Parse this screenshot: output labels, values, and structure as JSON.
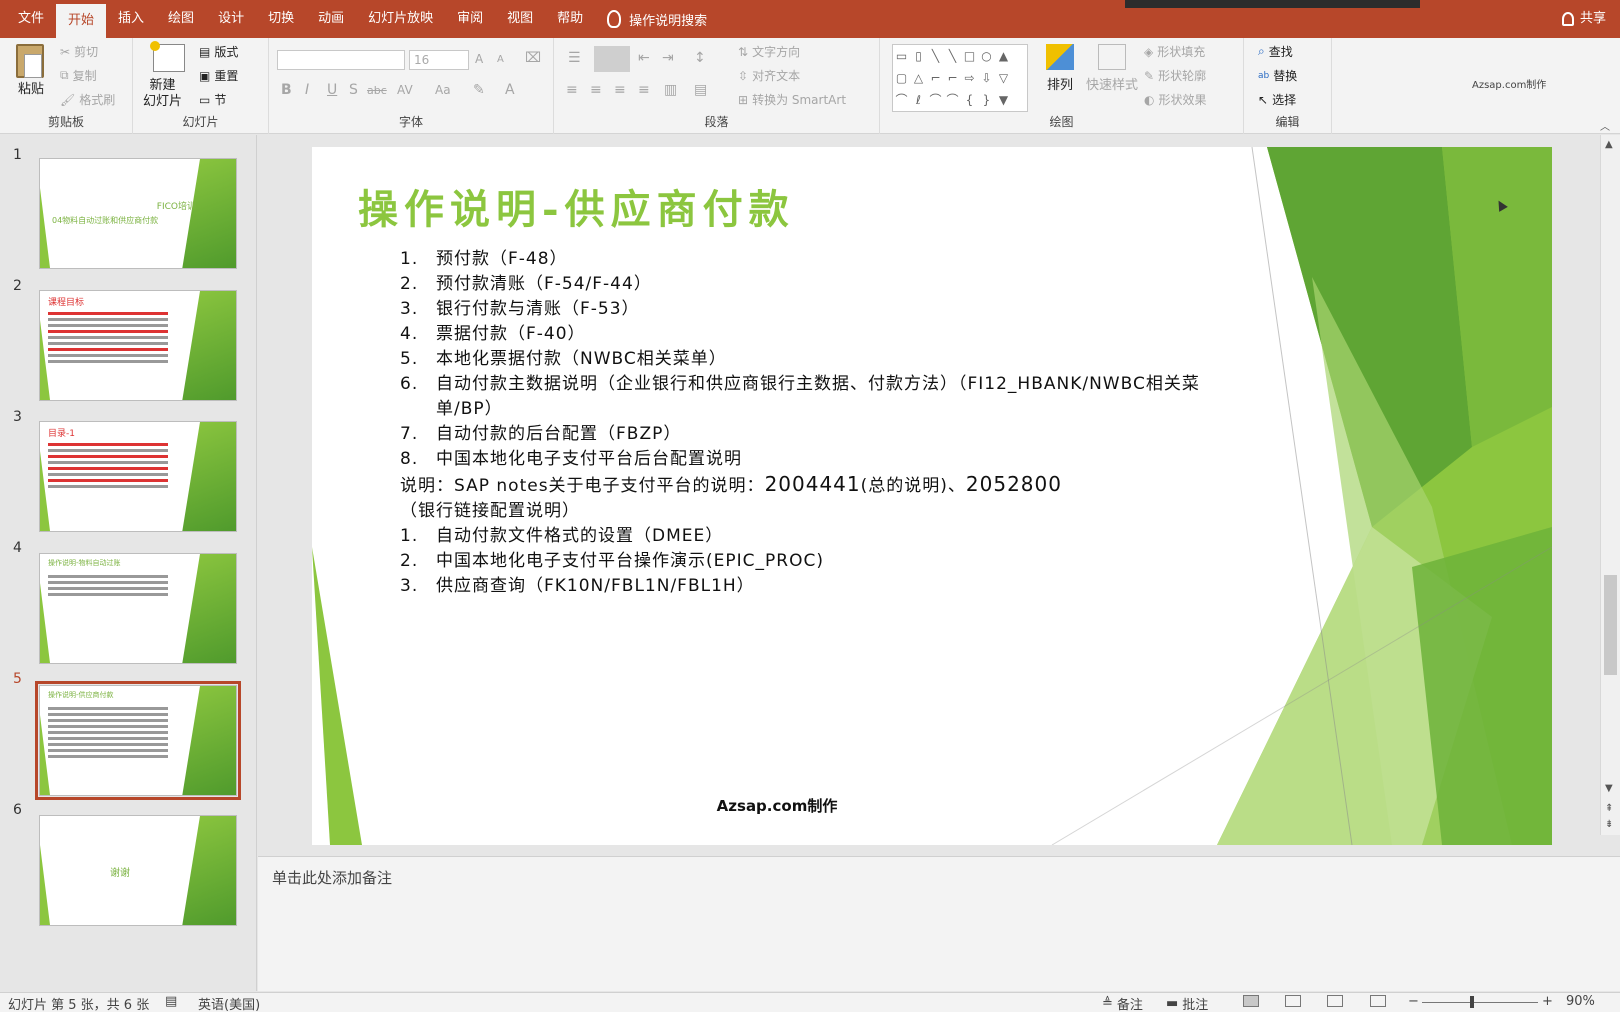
{
  "tabs": {
    "items": [
      "文件",
      "开始",
      "插入",
      "绘图",
      "设计",
      "切换",
      "动画",
      "幻灯片放映",
      "审阅",
      "视图",
      "帮助"
    ],
    "search": "操作说明搜索",
    "share": "共享"
  },
  "ribbon": {
    "clipboard": {
      "label": "剪贴板",
      "paste": "粘贴",
      "cut": "剪切",
      "copy": "复制",
      "format_painter": "格式刷"
    },
    "slides": {
      "label": "幻灯片",
      "new_slide_line1": "新建",
      "new_slide_line2": "幻灯片",
      "layout": "版式",
      "reset": "重置",
      "section": "节"
    },
    "font": {
      "label": "字体",
      "size": "16",
      "bold": "B",
      "italic": "I",
      "underline": "U",
      "shadow": "S",
      "strike": "abc",
      "spacing": "AV",
      "case": "Aa",
      "grow": "A",
      "shrink": "A"
    },
    "paragraph": {
      "label": "段落",
      "text_direction": "文字方向",
      "align_text": "对齐文本",
      "smartart": "转换为 SmartArt"
    },
    "drawing": {
      "label": "绘图",
      "arrange": "排列",
      "quick_styles": "快速样式",
      "shape_fill": "形状填充",
      "shape_outline": "形状轮廓",
      "shape_effects": "形状效果"
    },
    "editing": {
      "label": "编辑",
      "find": "查找",
      "replace": "替换",
      "select": "选择"
    },
    "watermark": "Azsap.com制作"
  },
  "thumbnails": [
    {
      "num": "1",
      "title": "FICO培训",
      "subtitle": "04物料自动过账和供应商付款"
    },
    {
      "num": "2",
      "title": "课程目标"
    },
    {
      "num": "3",
      "title": "目录-1"
    },
    {
      "num": "4",
      "title": "操作说明-物料自动过账"
    },
    {
      "num": "5",
      "title": "操作说明-供应商付款"
    },
    {
      "num": "6",
      "title": "谢谢"
    }
  ],
  "slide": {
    "title": "操作说明-供应商付款",
    "items_a": [
      {
        "n": "1.",
        "t": "预付款（F-48）"
      },
      {
        "n": "2.",
        "t": "预付款清账（F-54/F-44）"
      },
      {
        "n": "3.",
        "t": "银行付款与清账（F-53）"
      },
      {
        "n": "4.",
        "t": "票据付款（F-40）"
      },
      {
        "n": "5.",
        "t": "本地化票据付款（NWBC相关菜单）"
      },
      {
        "n": "6.",
        "t": "自动付款主数据说明（企业银行和供应商银行主数据、付款方法）（FI12_HBANK/NWBC相关菜单/BP）"
      },
      {
        "n": "7.",
        "t": "自动付款的后台配置（FBZP）"
      },
      {
        "n": "8.",
        "t": "中国本地化电子支付平台后台配置说明"
      }
    ],
    "note_prefix": "说明：SAP notes关于电子支付平台的说明：",
    "note_num1": "2004441",
    "note_mid": "(总的说明)、",
    "note_num2": "2052800",
    "note_suffix": "（银行链接配置说明）",
    "items_b": [
      {
        "n": "1.",
        "t": "自动付款文件格式的设置（DMEE）"
      },
      {
        "n": "2.",
        "t": "中国本地化电子支付平台操作演示(EPIC_PROC)"
      },
      {
        "n": "3.",
        "t": "供应商查询（FK10N/FBL1N/FBL1H）"
      }
    ],
    "footer": "Azsap.com制作"
  },
  "notes_placeholder": "单击此处添加备注",
  "status": {
    "slide_info": "幻灯片 第 5 张，共 6 张",
    "language": "英语(美国)",
    "notes": "备注",
    "comments": "批注",
    "zoom": "90%"
  },
  "colors": {
    "accent": "#b7472a",
    "slide_green": "#8cc63f",
    "dark_green": "#4f9a2c"
  }
}
